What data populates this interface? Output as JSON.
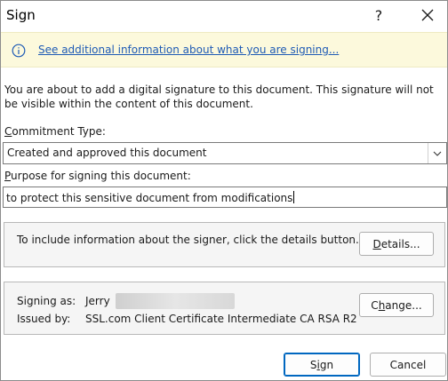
{
  "window": {
    "title": "Sign",
    "help_glyph": "?"
  },
  "infobar": {
    "icon": "info-icon",
    "link_text": "See additional information about what you are signing..."
  },
  "message": "You are about to add a digital signature to this document. This signature will not be visible within the content of this document.",
  "commitment": {
    "label_first": "C",
    "label_rest": "ommitment Type:",
    "selected": "Created and approved this document"
  },
  "purpose": {
    "label_first": "P",
    "label_rest": "urpose for signing this document:",
    "value": "to protect this sensitive document from modifications"
  },
  "details_group": {
    "text": "To include information about the signer, click the details button.",
    "button_first": "D",
    "button_rest": "etails..."
  },
  "signer_group": {
    "signing_as_label": "Signing as:",
    "signing_as_value": "Jerry",
    "issued_by_label": "Issued by:",
    "issued_by_value": "SSL.com Client Certificate Intermediate CA RSA R2",
    "change_button_pre": "C",
    "change_button_u": "h",
    "change_button_post": "ange..."
  },
  "buttons": {
    "sign_first": "S",
    "sign_u": "i",
    "sign_rest": "gn",
    "cancel": "Cancel"
  },
  "colors": {
    "infobar_bg": "#fcf9dc",
    "link": "#1f5bb5",
    "primary_border": "#0067c0"
  }
}
